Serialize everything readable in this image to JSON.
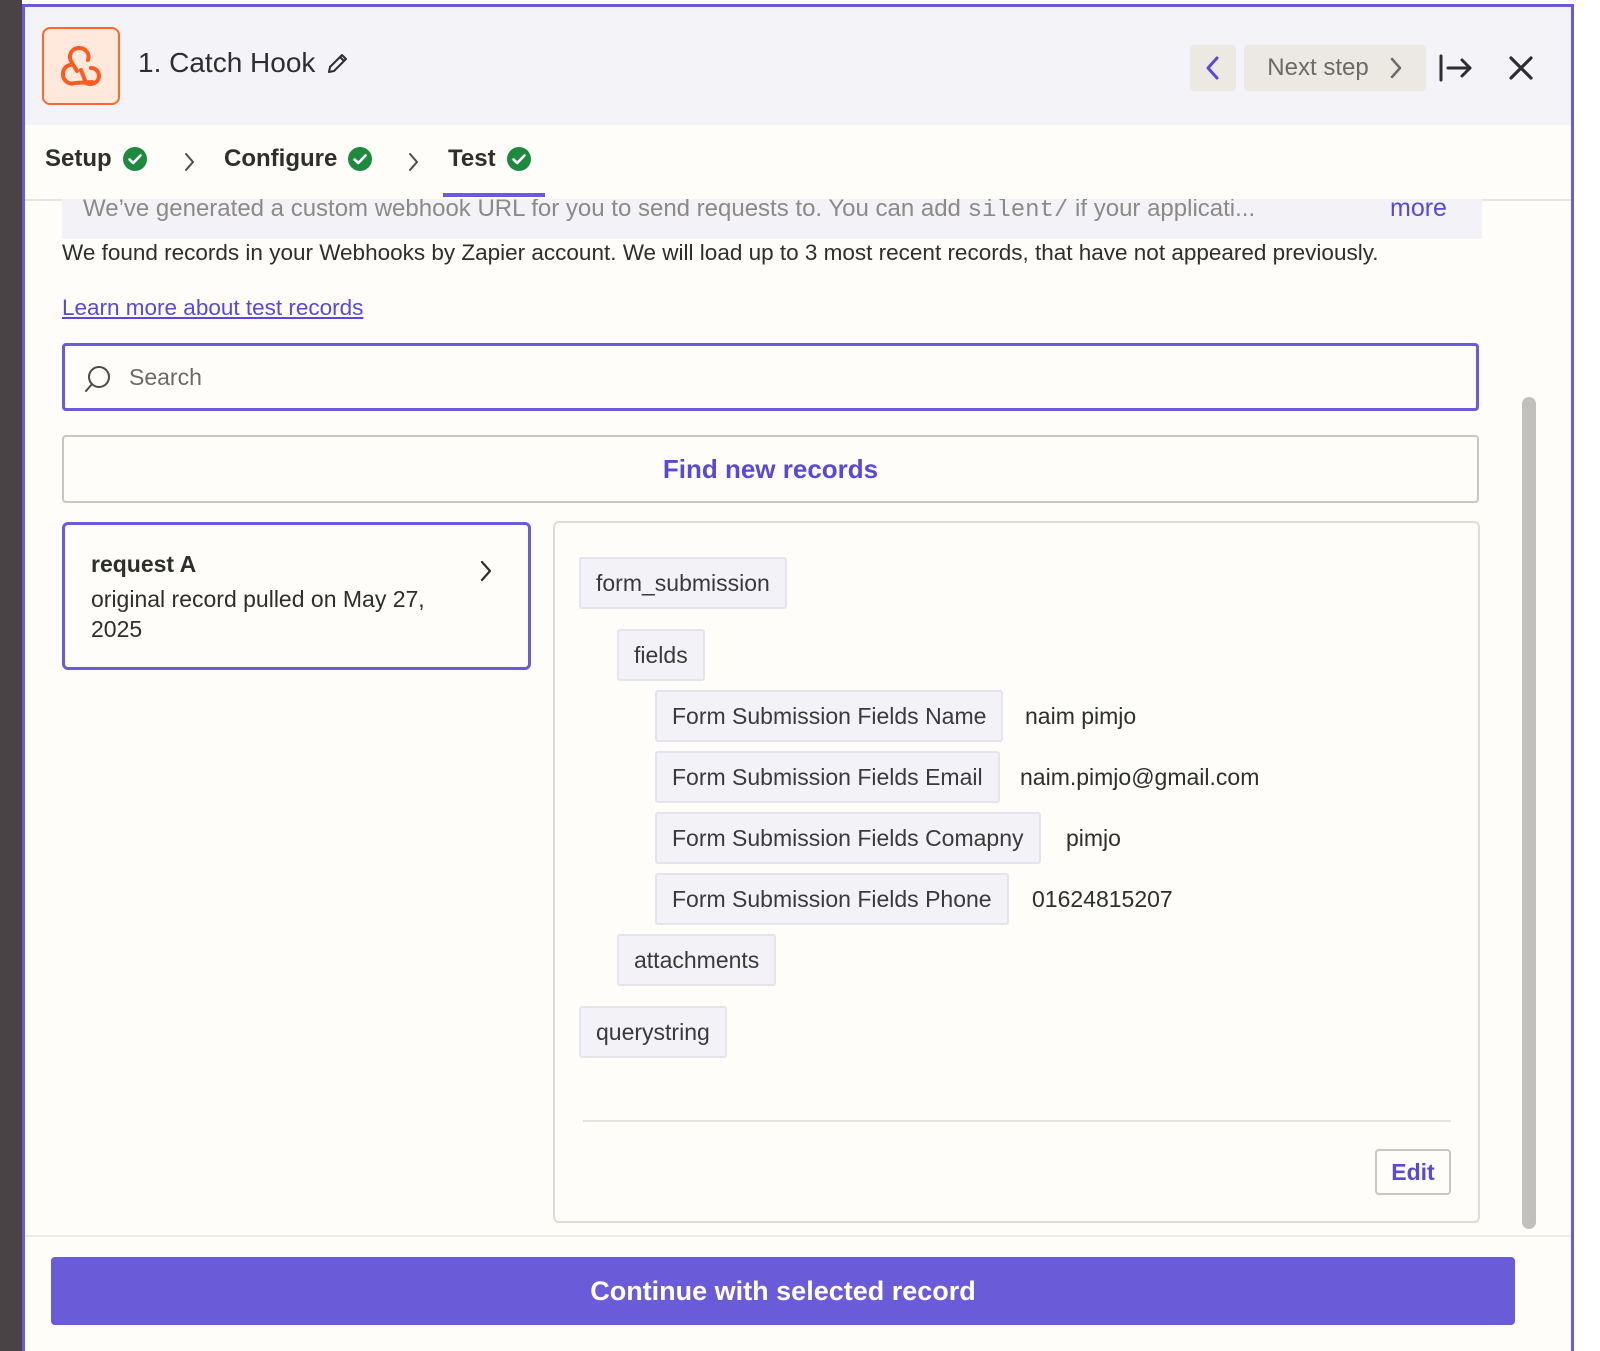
{
  "header": {
    "step_title": "1. Catch Hook",
    "next_step_label": "Next step"
  },
  "tabs": [
    {
      "label": "Setup",
      "complete": true
    },
    {
      "label": "Configure",
      "complete": true
    },
    {
      "label": "Test",
      "complete": true,
      "active": true
    }
  ],
  "info": {
    "banner_before": "We’ve generated a custom webhook URL for you to send requests to. You can add ",
    "banner_code": "silent/",
    "banner_after": " if your applicati...",
    "more_label": "more",
    "found_text": "We found records in your Webhooks by Zapier account. We will load up to 3 most recent records, that have not appeared previously.",
    "learn_more": "Learn more about test records"
  },
  "search": {
    "placeholder": "Search",
    "value": ""
  },
  "find_button": "Find new records",
  "record": {
    "title": "request A",
    "subtitle": "original record pulled on May 27, 2025"
  },
  "detail": {
    "root": "form_submission",
    "group_fields": "fields",
    "fields": [
      {
        "label": "Form Submission Fields Name",
        "value": "naim pimjo"
      },
      {
        "label": "Form Submission Fields Email",
        "value": "naim.pimjo@gmail.com"
      },
      {
        "label": "Form Submission Fields Comapny",
        "value": "pimjo"
      },
      {
        "label": "Form Submission Fields Phone",
        "value": "01624815207"
      }
    ],
    "group_attachments": "attachments",
    "querystring": "querystring",
    "edit_label": "Edit"
  },
  "footer": {
    "continue_label": "Continue with selected record"
  },
  "colors": {
    "accent": "#6a5bd8",
    "link": "#5849d6",
    "success": "#1e8a3e",
    "app_icon": "#ff6a2b"
  },
  "icons": {
    "app": "webhook-icon",
    "edit": "pencil-icon",
    "back": "chevron-left-icon",
    "next": "chevron-right-icon",
    "collapse": "arrow-to-right-icon",
    "close": "close-icon",
    "search": "search-icon",
    "check": "check-circle-icon"
  }
}
